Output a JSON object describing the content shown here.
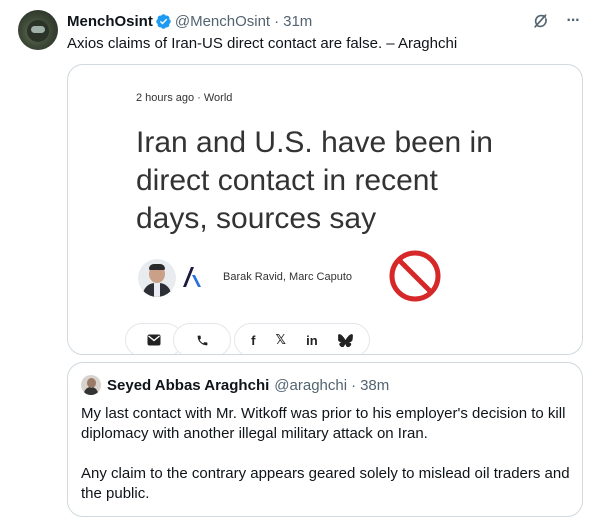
{
  "post": {
    "author": {
      "display_name": "MenchOsint",
      "handle": "@MenchOsint",
      "time": "31m",
      "verified": true,
      "avatar_icon": "pilot-helmet-avatar"
    },
    "separator": "·",
    "text": "Axios claims of Iran-US direct contact are false. – Araghchi",
    "actions": {
      "grok_icon": "grok-slash-icon",
      "more_icon": "more-dots-icon",
      "more_glyph": "···"
    }
  },
  "media_card": {
    "meta": "2 hours ago · World",
    "headline": "Iran and U.S. have been in direct contact in recent days, sources say",
    "authors": "Barak Ravid, Marc Caputo",
    "overlay_icon": "prohibited-sign-icon",
    "share_buttons": [
      {
        "name": "email",
        "icon": "envelope-icon",
        "glyph": ""
      },
      {
        "name": "phone",
        "icon": "phone-icon",
        "glyph": ""
      },
      {
        "name": "facebook",
        "icon": "facebook-icon",
        "glyph": "f"
      },
      {
        "name": "x",
        "icon": "x-logo-icon",
        "glyph": "𝕏"
      },
      {
        "name": "linkedin",
        "icon": "linkedin-icon",
        "glyph": "in"
      },
      {
        "name": "bluesky",
        "icon": "bluesky-butterfly-icon",
        "glyph": ""
      }
    ]
  },
  "quote": {
    "author": {
      "display_name": "Seyed Abbas Araghchi",
      "handle": "@araghchi",
      "time": "38m"
    },
    "separator": "·",
    "paragraphs": [
      "My last contact with Mr. Witkoff was prior to his employer's decision to kill diplomacy with another illegal military attack on Iran.",
      "Any claim to the contrary appears geared solely to mislead oil traders and the public."
    ]
  },
  "colors": {
    "text_primary": "#0f1419",
    "text_secondary": "#536471",
    "border": "#cfd9de",
    "verified_blue": "#1d9bf0",
    "prohibited_red": "#d62828",
    "axios_blue": "#1a1a40"
  }
}
